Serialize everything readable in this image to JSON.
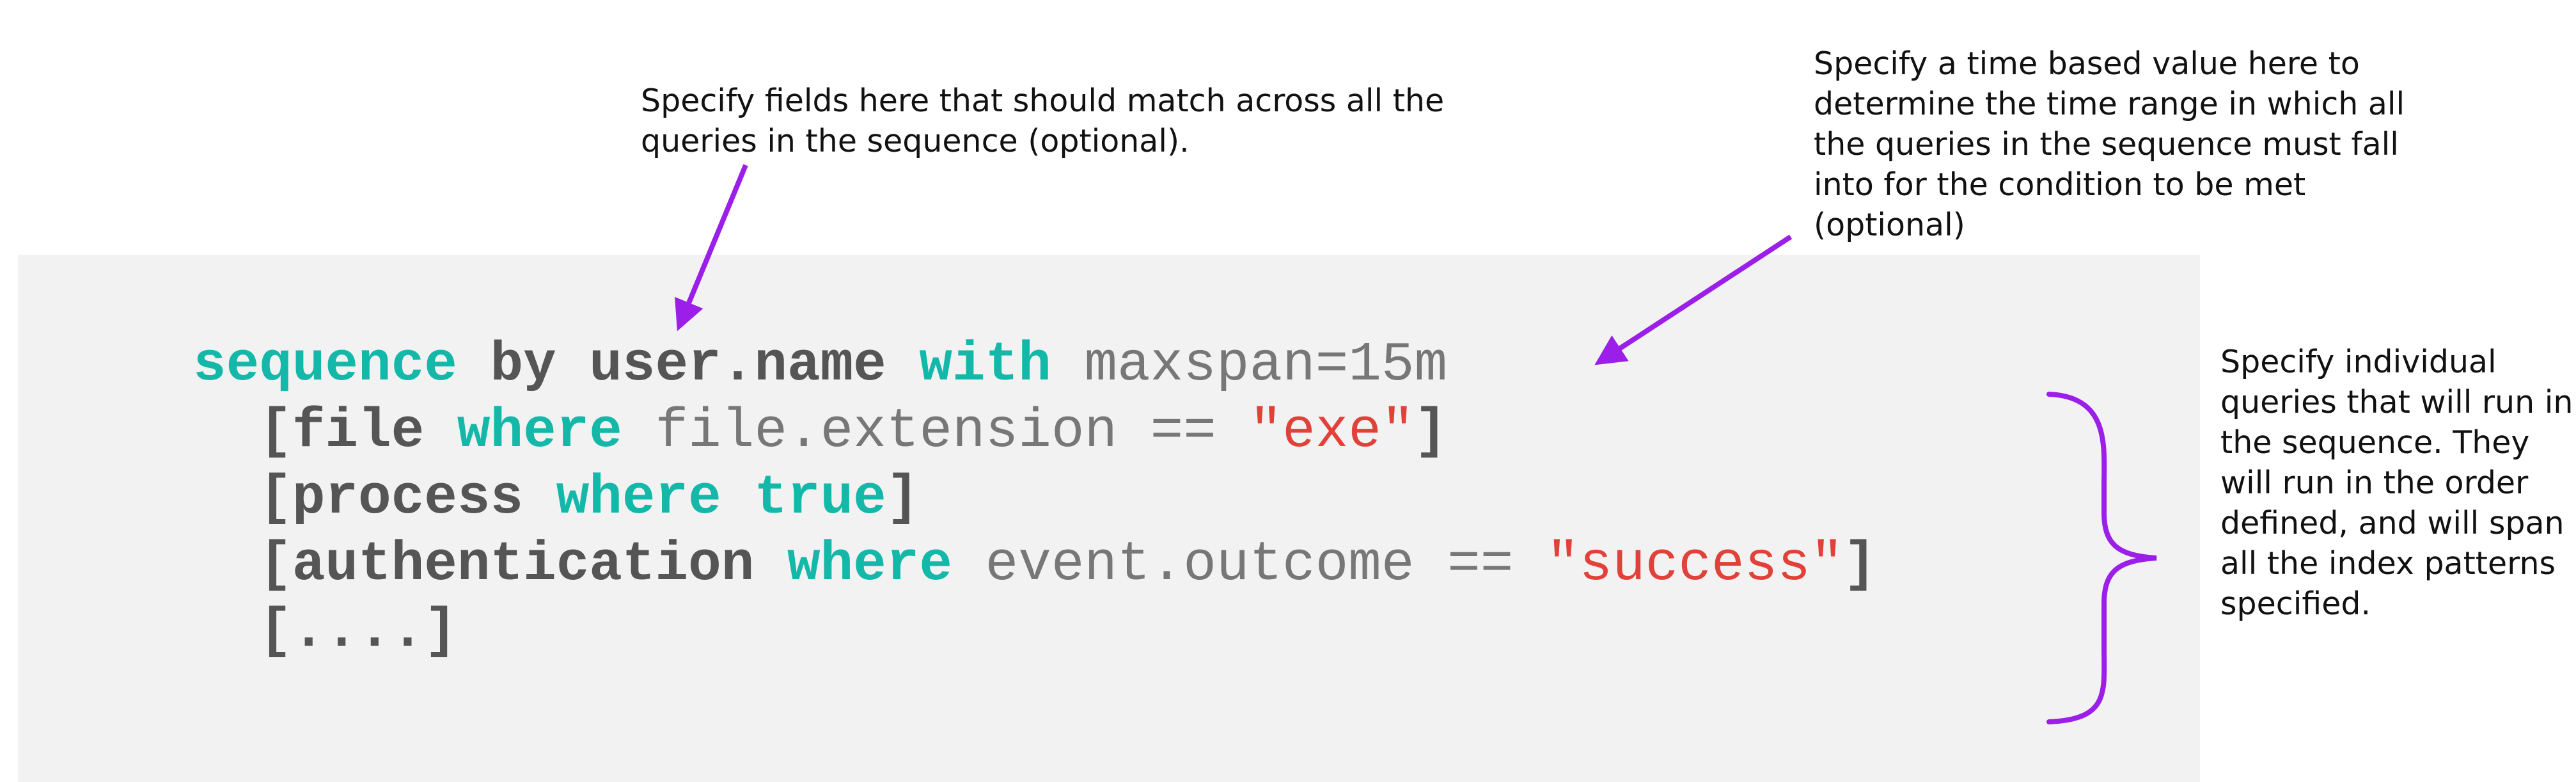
{
  "code": {
    "lines": [
      [
        {
          "text": "sequence",
          "style": "kw"
        },
        {
          "text": " by user.name ",
          "style": "dk"
        },
        {
          "text": "with",
          "style": "kw"
        },
        {
          "text": " maxspan=15m",
          "style": "plain"
        }
      ],
      [
        {
          "text": "  [file ",
          "style": "dk"
        },
        {
          "text": "where",
          "style": "kw"
        },
        {
          "text": " file.extension == ",
          "style": "plain"
        },
        {
          "text": "\"exe\"",
          "style": "str"
        },
        {
          "text": "]",
          "style": "dk"
        }
      ],
      [
        {
          "text": "  [process ",
          "style": "dk"
        },
        {
          "text": "where",
          "style": "kw"
        },
        {
          "text": " ",
          "style": "dk"
        },
        {
          "text": "true",
          "style": "kw"
        },
        {
          "text": "]",
          "style": "dk"
        }
      ],
      [
        {
          "text": "  [authentication ",
          "style": "dk"
        },
        {
          "text": "where",
          "style": "kw"
        },
        {
          "text": " event.outcome == ",
          "style": "plain"
        },
        {
          "text": "\"success\"",
          "style": "str"
        },
        {
          "text": "]",
          "style": "dk"
        }
      ],
      [
        {
          "text": "  [....]",
          "style": "dk"
        }
      ]
    ]
  },
  "annotations": {
    "fields_note": "Specify fields here that should match across all the\nqueries in the sequence (optional).",
    "time_note": "Specify a time based value here to\ndetermine the time range in which all\nthe queries in the sequence must fall\ninto for the condition to be met\n(optional)",
    "queries_note": "Specify individual\nqueries that will run in\nthe sequence. They\nwill run in the order\ndefined, and will span\nall the index patterns\nspecified."
  },
  "colors": {
    "keyword": "#14b8a9",
    "identifier": "#555555",
    "value": "#777777",
    "string": "#e2413a",
    "annotation_arrow": "#9b1fe8",
    "code_background": "#f2f2f2"
  }
}
